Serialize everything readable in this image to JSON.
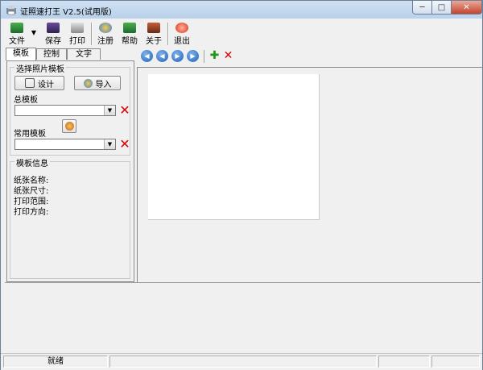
{
  "window": {
    "title": "证照速打王 V2.5(试用版)",
    "min_label": "─",
    "max_label": "□",
    "close_label": "✕"
  },
  "toolbar": {
    "file": "文件",
    "save": "保存",
    "print": "打印",
    "register": "注册",
    "help": "帮助",
    "about": "关于",
    "exit": "退出"
  },
  "tabs": [
    "模板",
    "控制",
    "文字"
  ],
  "template_panel": {
    "group_title": "选择照片模板",
    "design_button": "设计",
    "import_button": "导入",
    "total_label": "总模板",
    "common_label": "常用模板"
  },
  "info_panel": {
    "group_title": "模板信息",
    "paper_name": "纸张名称:",
    "paper_size": "纸张尺寸:",
    "print_range": "打印范围:",
    "print_direction": "打印方向:"
  },
  "nav": {
    "first": "◀",
    "prev": "◀",
    "next": "▶",
    "last": "▶",
    "add": "✚",
    "delete": "✕"
  },
  "status": {
    "text": "就绪"
  },
  "colors": {
    "title_bar": "#c4d8ee",
    "delete_red": "#dd0000",
    "add_green": "#1a9a1a"
  }
}
